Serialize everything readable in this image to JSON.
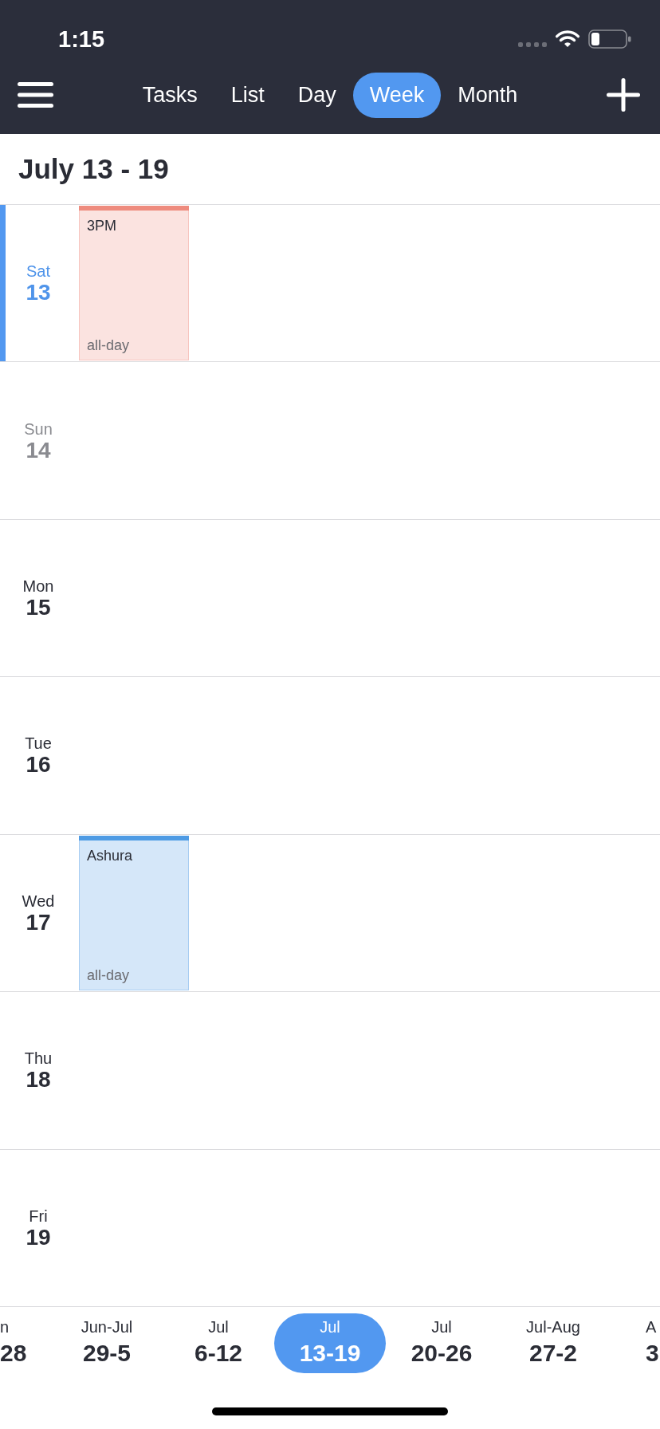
{
  "status_bar": {
    "time": "1:15"
  },
  "nav": {
    "tabs": [
      {
        "label": "Tasks",
        "selected": false
      },
      {
        "label": "List",
        "selected": false
      },
      {
        "label": "Day",
        "selected": false
      },
      {
        "label": "Week",
        "selected": true
      },
      {
        "label": "Month",
        "selected": false
      }
    ]
  },
  "header": {
    "title": "July 13 - 19"
  },
  "days": [
    {
      "weekday": "Sat",
      "day": "13",
      "selected": true,
      "dimmed": false,
      "events": [
        {
          "title": "3PM",
          "note": "all-day",
          "color": "#ee8b7e"
        }
      ]
    },
    {
      "weekday": "Sun",
      "day": "14",
      "selected": false,
      "dimmed": true
    },
    {
      "weekday": "Mon",
      "day": "15",
      "selected": false,
      "dimmed": false
    },
    {
      "weekday": "Tue",
      "day": "16",
      "selected": false,
      "dimmed": false
    },
    {
      "weekday": "Wed",
      "day": "17",
      "selected": false,
      "dimmed": false,
      "events": [
        {
          "title": "Ashura",
          "note": "all-day",
          "color": "#4e9be4"
        }
      ]
    },
    {
      "weekday": "Thu",
      "day": "18",
      "selected": false,
      "dimmed": false
    },
    {
      "weekday": "Fri",
      "day": "19",
      "selected": false,
      "dimmed": false
    }
  ],
  "week_strip": [
    {
      "kind": "leading",
      "month": "n",
      "range": "28",
      "selected": false
    },
    {
      "kind": "week",
      "month": "Jun-Jul",
      "range": "29-5",
      "selected": false
    },
    {
      "kind": "week",
      "month": "Jul",
      "range": "6-12",
      "selected": false
    },
    {
      "kind": "week",
      "month": "Jul",
      "range": "13-19",
      "selected": true
    },
    {
      "kind": "week",
      "month": "Jul",
      "range": "20-26",
      "selected": false
    },
    {
      "kind": "week",
      "month": "Jul-Aug",
      "range": "27-2",
      "selected": false
    },
    {
      "kind": "trailing",
      "month": "A",
      "range": "3",
      "selected": false
    }
  ]
}
